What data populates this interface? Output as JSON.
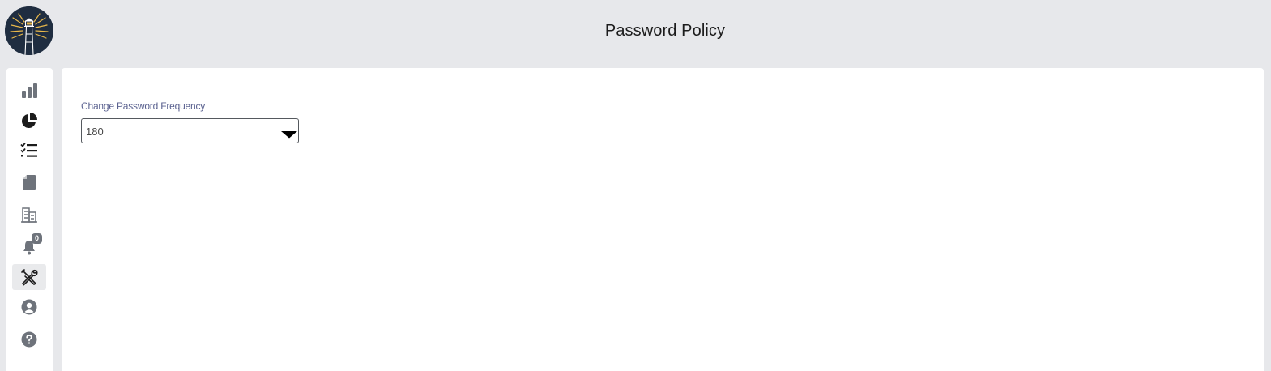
{
  "header": {
    "title": "Password Policy",
    "logo_icon": "lighthouse-logo"
  },
  "sidebar": {
    "items": [
      {
        "icon": "bar-chart-icon",
        "active": false
      },
      {
        "icon": "pie-chart-icon",
        "active": false
      },
      {
        "icon": "checklist-icon",
        "active": false
      },
      {
        "icon": "document-icon",
        "active": false
      },
      {
        "icon": "buildings-icon",
        "active": false
      },
      {
        "icon": "bell-icon",
        "active": false,
        "badge": "0"
      },
      {
        "icon": "tools-icon",
        "active": true
      },
      {
        "icon": "user-circle-icon",
        "active": false
      },
      {
        "icon": "help-circle-icon",
        "active": false
      }
    ]
  },
  "form": {
    "frequency_label": "Change Password Frequency",
    "frequency_value": "180"
  },
  "colors": {
    "background": "#e7e8eb",
    "panel": "#ffffff",
    "icon": "#6e737b",
    "label": "#5b6290",
    "logo_bg": "#1f2d40",
    "logo_accent": "#e8b84a"
  }
}
